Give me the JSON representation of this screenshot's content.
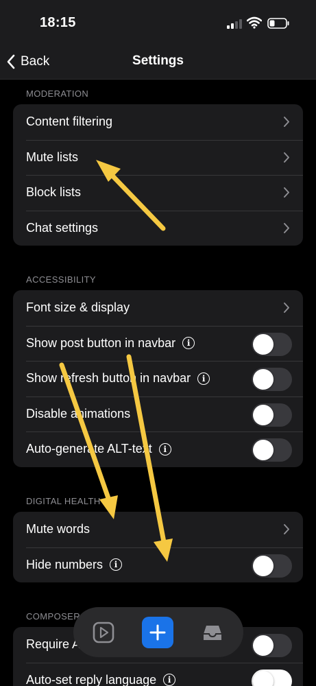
{
  "status": {
    "time": "18:15"
  },
  "nav": {
    "back_label": "Back",
    "title": "Settings"
  },
  "sections": {
    "moderation": {
      "header": "MODERATION",
      "items": [
        "Content filtering",
        "Mute lists",
        "Block lists",
        "Chat settings"
      ]
    },
    "accessibility": {
      "header": "ACCESSIBILITY",
      "items": [
        "Font size & display",
        "Show post button in navbar",
        "Show refresh button in navbar",
        "Disable animations",
        "Auto-generate ALT-text"
      ]
    },
    "digital_health": {
      "header": "DIGITAL HEALTH",
      "items": [
        "Mute words",
        "Hide numbers"
      ]
    },
    "composer": {
      "header": "COMPOSER",
      "items": [
        "Require ALT-text",
        "Auto-set reply language"
      ]
    }
  },
  "toggles": {
    "show_post_button": false,
    "show_refresh_button": false,
    "disable_animations": false,
    "auto_generate_alt": false,
    "hide_numbers": false,
    "require_alt": false
  },
  "tabbar": {
    "icons": [
      "play-icon",
      "plus-icon",
      "inbox-icon"
    ],
    "accent_color": "#1a73e8"
  },
  "annotation_color": "#f5c842",
  "info_glyph": "i"
}
